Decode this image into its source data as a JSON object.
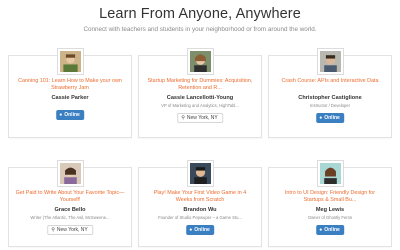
{
  "header": {
    "title": "Learn From Anyone, Anywhere",
    "subtitle": "Connect with teachers and students in your neighborhood or from around the world."
  },
  "cards": [
    {
      "title": "Canning 101: Learn How to Make your own Strawberry Jam",
      "teacher": "Cassie Parker",
      "role": "",
      "badge": "Online",
      "badge_type": "online",
      "badge_icon": "globe-icon"
    },
    {
      "title": "Startup Marketing for Dummies: Acquisition, Retention and R...",
      "teacher": "Cassie Lancellotti-Young",
      "role": "VP of Marketing and Analytics, HighTabl...",
      "badge": "New York, NY",
      "badge_type": "location",
      "badge_icon": "map-pin-icon"
    },
    {
      "title": "Crash Course: APIs and Interactive Data",
      "teacher": "Christopher Castiglione",
      "role": "Instructor / Developer",
      "badge": "Online",
      "badge_type": "online",
      "badge_icon": "globe-icon"
    },
    {
      "title": "Get Paid to Write About Your Favorite Topic—Yourself!",
      "teacher": "Grace Bello",
      "role": "Writer (The Atlantic, The Awl, McSweene...",
      "badge": "New York, NY",
      "badge_type": "location",
      "badge_icon": "map-pin-icon"
    },
    {
      "title": "Play! Make Your First Video Game in 4 Weeks from Scratch",
      "teacher": "Brandon Wu",
      "role": "Founder of Studio Pepwuper – a Game Stu...",
      "badge": "Online",
      "badge_type": "online",
      "badge_icon": "globe-icon"
    },
    {
      "title": "Intro to UI Design: Friendly Design for Startups & Small Bu...",
      "teacher": "Meg Lewis",
      "role": "Owner of Ghostly Ferns",
      "badge": "Online",
      "badge_type": "online",
      "badge_icon": "globe-icon"
    }
  ],
  "colors": {
    "accent": "#ec6b2d",
    "online_badge": "#3a7fc1"
  }
}
